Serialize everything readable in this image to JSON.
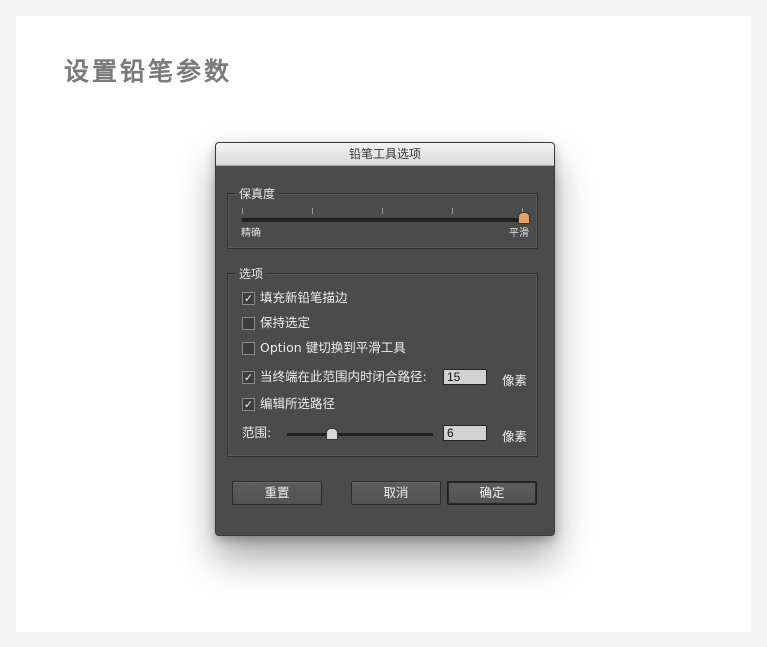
{
  "page": {
    "heading": "设置铅笔参数"
  },
  "dialog": {
    "title": "铅笔工具选项",
    "fidelity": {
      "label": "保真度",
      "min_label": "精确",
      "max_label": "平滑",
      "value_fraction": 1.0
    },
    "options": {
      "label": "选项",
      "fill_new": {
        "label": "填充新铅笔描边",
        "checked": true
      },
      "keep_selected": {
        "label": "保持选定",
        "checked": false
      },
      "option_key": {
        "label": "Option 键切换到平滑工具",
        "checked": false
      },
      "close_paths": {
        "label": "当终端在此范围内时闭合路径:",
        "checked": true,
        "value": "15",
        "unit": "像素"
      },
      "edit_selected": {
        "label": "编辑所选路径",
        "checked": true
      },
      "range": {
        "label": "范围:",
        "value": "6",
        "unit": "像素",
        "value_fraction": 0.3
      }
    },
    "buttons": {
      "reset": "重置",
      "cancel": "取消",
      "ok": "确定"
    },
    "check_glyph": "✓",
    "accent_color": "#e2a35a"
  }
}
